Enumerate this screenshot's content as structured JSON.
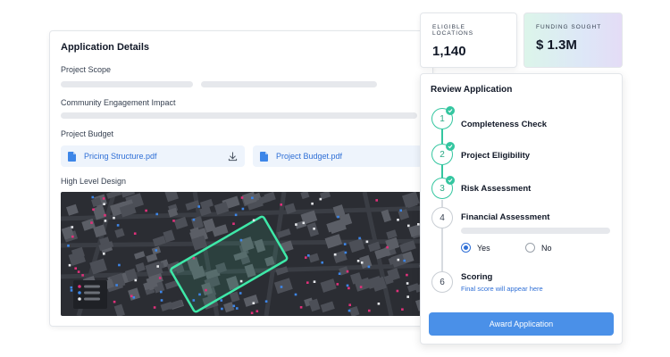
{
  "application": {
    "title": "Application Details",
    "scope_label": "Project Scope",
    "engagement_label": "Community Engagement Impact",
    "budget_label": "Project Budget",
    "files": [
      {
        "name": "Pricing Structure.pdf",
        "icon": "document-icon",
        "action_icon": "download-icon"
      },
      {
        "name": "Project Budget.pdf",
        "icon": "document-icon",
        "action_icon": "download-icon"
      }
    ],
    "design_label": "High Level Design"
  },
  "stats": {
    "locations": {
      "label": "Eligible Locations",
      "value": "1,140"
    },
    "funding": {
      "label": "Funding Sought",
      "value": "$ 1.3M"
    }
  },
  "review": {
    "title": "Review Application",
    "steps": [
      {
        "number": "1",
        "label": "Completeness Check",
        "status": "complete"
      },
      {
        "number": "2",
        "label": "Project Eligibility",
        "status": "complete"
      },
      {
        "number": "3",
        "label": "Risk Assessment",
        "status": "complete"
      },
      {
        "number": "4",
        "label": "Financial Assessment",
        "status": "current"
      },
      {
        "number": "6",
        "label": "Scoring",
        "status": "pending",
        "sublabel": "Final score will appear here"
      }
    ],
    "options": {
      "yes": "Yes",
      "no": "No",
      "selected": "yes"
    },
    "award_button": "Award Application"
  },
  "colors": {
    "accent": "#4a90e8",
    "success": "#34c6a0",
    "highlight": "#3ee8a8",
    "map_background": "#2b2d33",
    "map_point_pink": "#e0307a",
    "map_point_blue": "#3d86e8"
  }
}
